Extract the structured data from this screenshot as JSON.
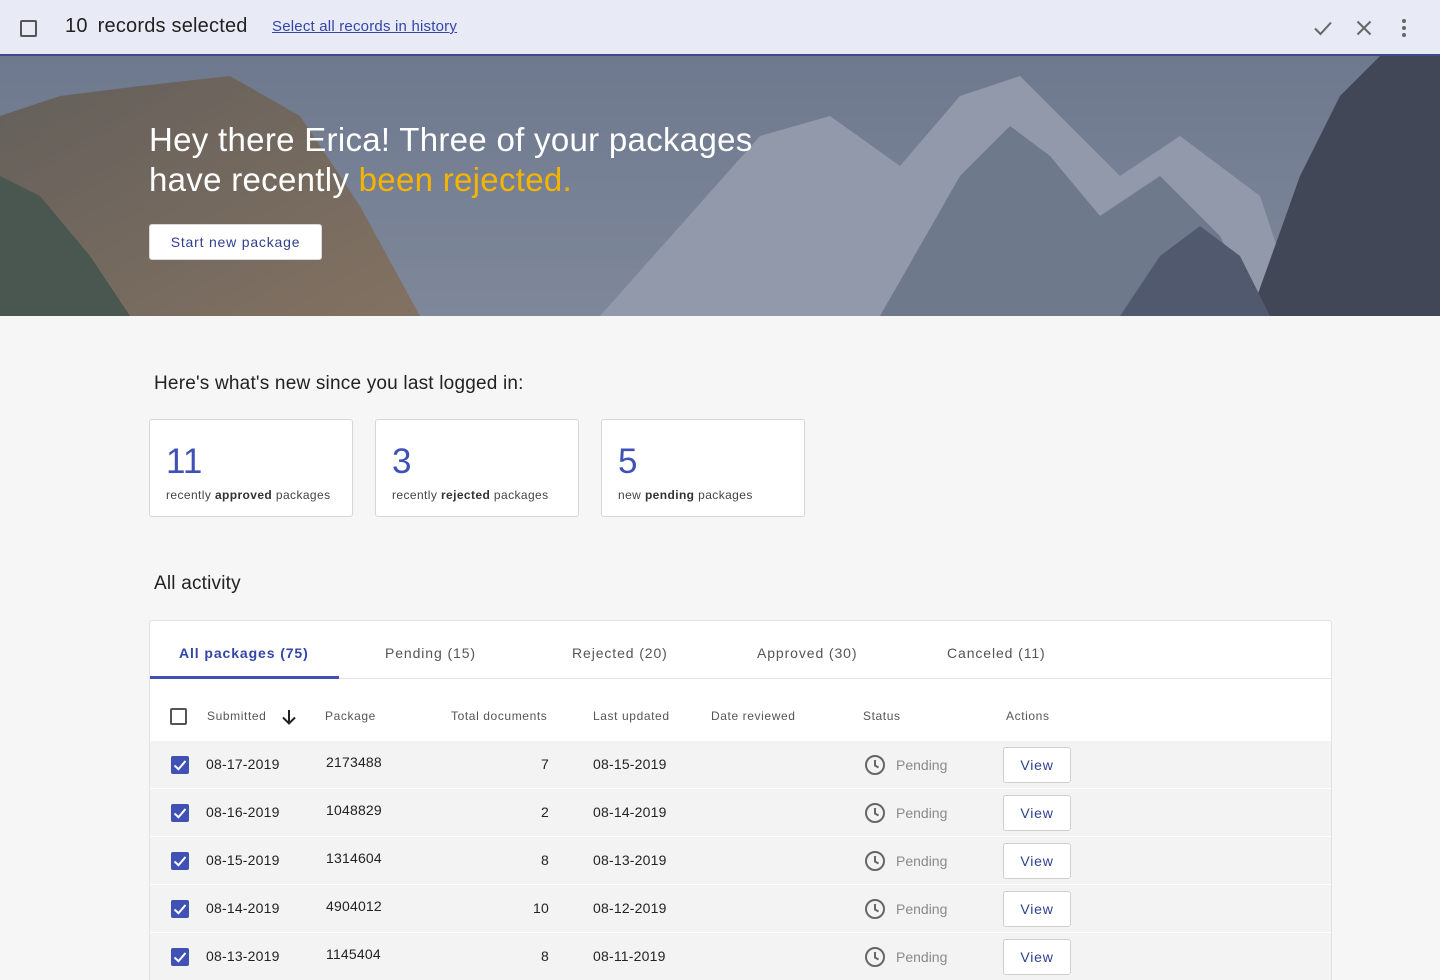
{
  "selection_bar": {
    "count": "10",
    "label": "records selected",
    "select_all_link": "Select all records in history"
  },
  "hero": {
    "headline_line1": "Hey there Erica! Three of your packages",
    "headline_line2_prefix": "have recently ",
    "headline_line2_accent": "been rejected.",
    "start_button": "Start new package"
  },
  "news": {
    "heading": "Here's what's new since you last logged in:",
    "stats": [
      {
        "value": "11",
        "prefix": "recently ",
        "bold": "approved",
        "suffix": " packages"
      },
      {
        "value": "3",
        "prefix": "recently ",
        "bold": "rejected",
        "suffix": " packages"
      },
      {
        "value": "5",
        "prefix": "new ",
        "bold": "pending",
        "suffix": " packages"
      }
    ]
  },
  "activity": {
    "heading": "All activity",
    "tabs": [
      "All packages (75)",
      "Pending (15)",
      "Rejected (20)",
      "Approved (30)",
      "Canceled (11)"
    ],
    "active_tab": 0,
    "columns": [
      "Submitted",
      "Package",
      "Total documents",
      "Last updated",
      "Date reviewed",
      "Status",
      "Actions"
    ],
    "rows": [
      {
        "submitted": "08-17-2019",
        "package": "2173488",
        "total_documents": "7",
        "last_updated": "08-15-2019",
        "date_reviewed": "",
        "status": "Pending",
        "action": "View",
        "checked": true
      },
      {
        "submitted": "08-16-2019",
        "package": "1048829",
        "total_documents": "2",
        "last_updated": "08-14-2019",
        "date_reviewed": "",
        "status": "Pending",
        "action": "View",
        "checked": true
      },
      {
        "submitted": "08-15-2019",
        "package": "1314604",
        "total_documents": "8",
        "last_updated": "08-13-2019",
        "date_reviewed": "",
        "status": "Pending",
        "action": "View",
        "checked": true
      },
      {
        "submitted": "08-14-2019",
        "package": "4904012",
        "total_documents": "10",
        "last_updated": "08-12-2019",
        "date_reviewed": "",
        "status": "Pending",
        "action": "View",
        "checked": true
      },
      {
        "submitted": "08-13-2019",
        "package": "1145404",
        "total_documents": "8",
        "last_updated": "08-11-2019",
        "date_reviewed": "",
        "status": "Pending",
        "action": "View",
        "checked": true
      }
    ]
  },
  "colors": {
    "primary": "#3f51b5",
    "accent": "#f5b400",
    "selection_bar_bg": "#e8eaf6"
  },
  "icons": [
    "check-icon",
    "close-icon",
    "more-vert-icon",
    "arrow-down-icon",
    "clock-icon",
    "checkbox-icon"
  ]
}
